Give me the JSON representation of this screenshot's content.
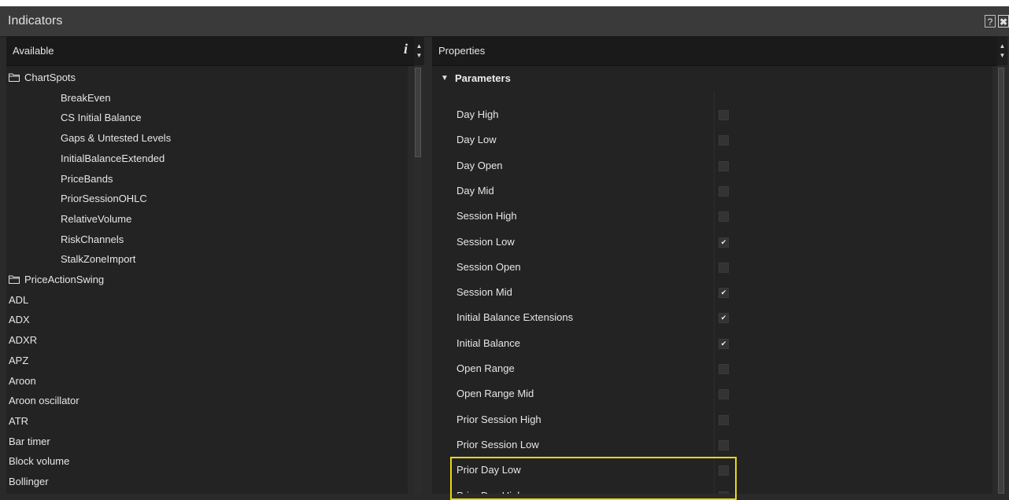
{
  "window": {
    "title": "Indicators",
    "help_glyph": "?",
    "close_glyph": "✖"
  },
  "available_panel": {
    "header": "Available",
    "info_glyph": "i",
    "items": [
      {
        "label": "ChartSpots",
        "kind": "folder"
      },
      {
        "label": "BreakEven",
        "kind": "child"
      },
      {
        "label": "CS Initial Balance",
        "kind": "child"
      },
      {
        "label": "Gaps & Untested Levels",
        "kind": "child"
      },
      {
        "label": "InitialBalanceExtended",
        "kind": "child"
      },
      {
        "label": "PriceBands",
        "kind": "child"
      },
      {
        "label": "PriorSessionOHLC",
        "kind": "child"
      },
      {
        "label": "RelativeVolume",
        "kind": "child"
      },
      {
        "label": "RiskChannels",
        "kind": "child"
      },
      {
        "label": "StalkZoneImport",
        "kind": "child"
      },
      {
        "label": "PriceActionSwing",
        "kind": "folder"
      },
      {
        "label": "ADL",
        "kind": "top"
      },
      {
        "label": "ADX",
        "kind": "top"
      },
      {
        "label": "ADXR",
        "kind": "top"
      },
      {
        "label": "APZ",
        "kind": "top"
      },
      {
        "label": "Aroon",
        "kind": "top"
      },
      {
        "label": "Aroon oscillator",
        "kind": "top"
      },
      {
        "label": "ATR",
        "kind": "top"
      },
      {
        "label": "Bar timer",
        "kind": "top"
      },
      {
        "label": "Block volume",
        "kind": "top"
      },
      {
        "label": "Bollinger",
        "kind": "top"
      }
    ]
  },
  "properties_panel": {
    "header": "Properties",
    "section_label": "Parameters",
    "parameters": [
      {
        "label": "Day High",
        "checked": false
      },
      {
        "label": "Day Low",
        "checked": false
      },
      {
        "label": "Day Open",
        "checked": false
      },
      {
        "label": "Day Mid",
        "checked": false
      },
      {
        "label": "Session High",
        "checked": false
      },
      {
        "label": "Session Low",
        "checked": true
      },
      {
        "label": "Session Open",
        "checked": false
      },
      {
        "label": "Session Mid",
        "checked": true
      },
      {
        "label": "Initial Balance Extensions",
        "checked": true
      },
      {
        "label": "Initial Balance",
        "checked": true
      },
      {
        "label": "Open Range",
        "checked": false
      },
      {
        "label": "Open Range Mid",
        "checked": false
      },
      {
        "label": "Prior Session High",
        "checked": false
      },
      {
        "label": "Prior Session Low",
        "checked": false
      },
      {
        "label": "Prior Day Low",
        "checked": false
      },
      {
        "label": "Prior Day High",
        "checked": false
      }
    ],
    "check_glyph": "✔"
  },
  "colors": {
    "highlight": "#e8d816"
  }
}
